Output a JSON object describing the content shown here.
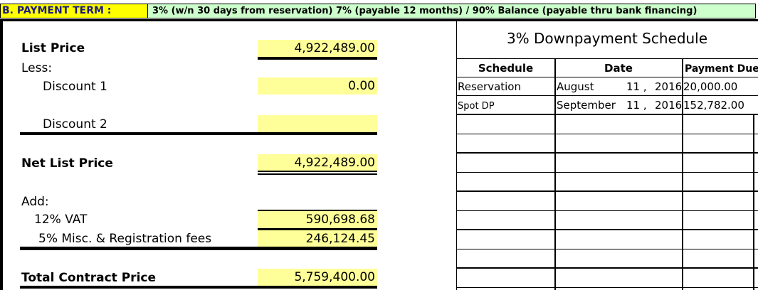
{
  "header": {
    "label": "B. PAYMENT TERM :",
    "terms": "3% (w/n 30 days from reservation) 7% (payable 12 months) / 90% Balance (payable thru bank financing)"
  },
  "pricing": {
    "list_price_label": "List Price",
    "list_price_value": "4,922,489.00",
    "less_label": "Less:",
    "discount1_label": "Discount 1",
    "discount1_value": "0.00",
    "discount2_label": "Discount 2",
    "discount2_value": "",
    "net_list_price_label": "Net List Price",
    "net_list_price_value": "4,922,489.00",
    "add_label": "Add:",
    "vat_label": "12% VAT",
    "vat_value": "590,698.68",
    "misc_label": "5% Misc. & Registration fees",
    "misc_value": "246,124.45",
    "total_label": "Total Contract Price",
    "total_value": "5,759,400.00"
  },
  "schedule": {
    "title": "3% Downpayment Schedule",
    "columns": [
      "Schedule",
      "Date",
      "Payment Due"
    ],
    "rows": [
      {
        "schedule": "Reservation",
        "month": "August",
        "day": "11 ,",
        "year": "2016",
        "payment": "20,000.00"
      },
      {
        "schedule": "Spot DP",
        "month": "September",
        "day": "11 ,",
        "year": "2016",
        "payment": "152,782.00"
      }
    ]
  }
}
